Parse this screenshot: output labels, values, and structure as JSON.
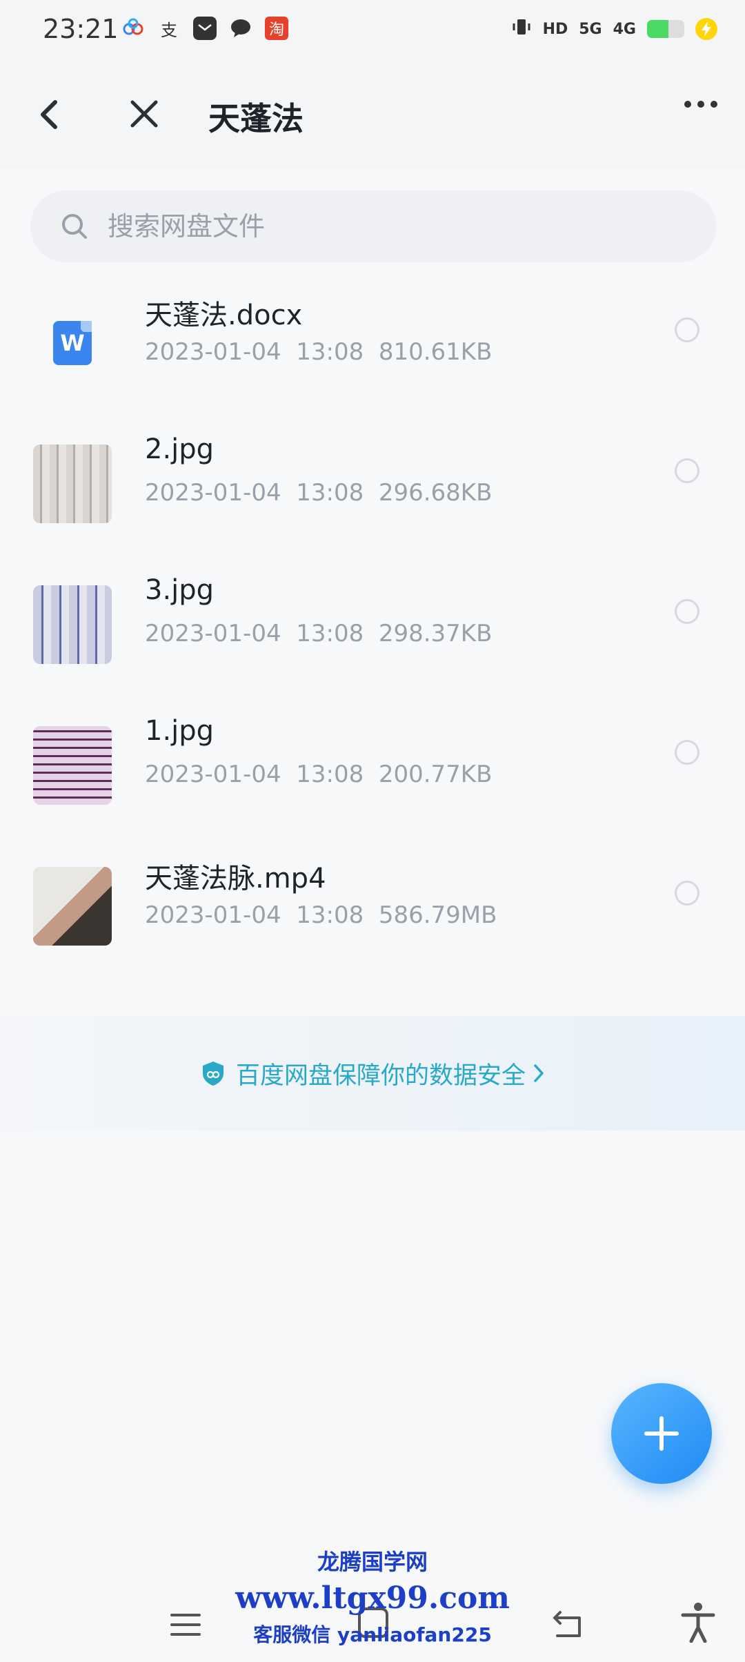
{
  "status_bar": {
    "time": "23:21",
    "left_icons": [
      "cloud-icon",
      "alipay-icon",
      "mail-icon",
      "chat-icon",
      "taobao-icon"
    ],
    "alipay_glyph": "支",
    "taobao_glyph": "淘",
    "network_hd": "HD",
    "network_5g": "5G",
    "network_4g": "4G",
    "battery_level": 0.58
  },
  "header": {
    "title": "天蓬法"
  },
  "search": {
    "placeholder": "搜索网盘文件"
  },
  "files": [
    {
      "name": "天蓬法.docx",
      "date": "2023-01-04",
      "time": "13:08",
      "size": "810.61KB",
      "type": "doc",
      "icon_letter": "W"
    },
    {
      "name": "2.jpg",
      "date": "2023-01-04",
      "time": "13:08",
      "size": "296.68KB",
      "type": "image"
    },
    {
      "name": "3.jpg",
      "date": "2023-01-04",
      "time": "13:08",
      "size": "298.37KB",
      "type": "image"
    },
    {
      "name": "1.jpg",
      "date": "2023-01-04",
      "time": "13:08",
      "size": "200.77KB",
      "type": "image"
    },
    {
      "name": "天蓬法脉.mp4",
      "date": "2023-01-04",
      "time": "13:08",
      "size": "586.79MB",
      "type": "video"
    }
  ],
  "safety_banner": {
    "text": "百度网盘保障你的数据安全"
  },
  "watermark": {
    "site": "龙腾国学网",
    "url": "www.ltgx99.com",
    "contact": "客服微信 yanliaofan225"
  },
  "colors": {
    "accent": "#1f8bf4",
    "safety_text": "#29a9c7",
    "meta_text": "#9aa0aa",
    "watermark": "#1d3fc6"
  }
}
